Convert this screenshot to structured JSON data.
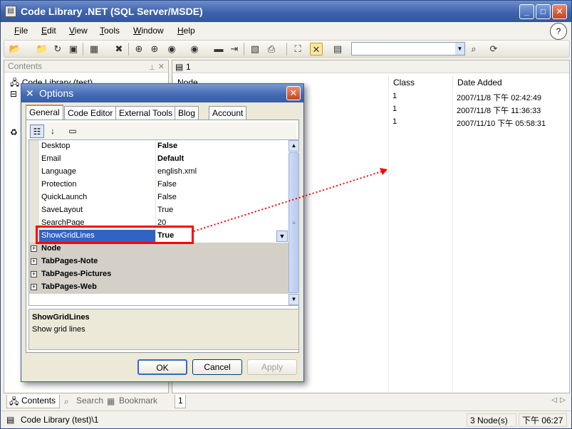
{
  "app": {
    "title": "Code Library .NET (SQL Server/MSDE)",
    "window_buttons": [
      "_",
      "□",
      "✕"
    ]
  },
  "menu": [
    {
      "label": "File",
      "u": "F",
      "rest": "ile"
    },
    {
      "label": "Edit",
      "u": "E",
      "rest": "dit"
    },
    {
      "label": "View",
      "u": "V",
      "rest": "iew"
    },
    {
      "label": "Tools",
      "u": "T",
      "rest": "ools"
    },
    {
      "label": "Window",
      "u": "W",
      "rest": "indow"
    },
    {
      "label": "Help",
      "u": "H",
      "rest": "elp"
    }
  ],
  "left_panel": {
    "title": "Contents",
    "root": "Code Library (test)"
  },
  "right_panel": {
    "tab_label": "1",
    "columns": [
      "Node",
      "Class",
      "Date Added"
    ],
    "rows": [
      {
        "class": "1",
        "date": "2007/11/8 下午 02:42:49"
      },
      {
        "class": "1",
        "date": "2007/11/8 下午 11:36:33"
      },
      {
        "class": "1",
        "date": "2007/11/10 下午 05:58:31"
      }
    ],
    "bottom_tab": "1"
  },
  "bottom_tabs": [
    "Contents",
    "Search",
    "Bookmark"
  ],
  "statusbar": {
    "path": "Code Library (test)\\1",
    "count": "3 Node(s)",
    "time": "下午 06:27"
  },
  "dialog": {
    "title": "Options",
    "tabs": [
      "General",
      "Code Editor",
      "External Tools",
      "Blog",
      "Account"
    ],
    "properties": [
      {
        "name": "Desktop",
        "value": "False",
        "bold": true
      },
      {
        "name": "Email",
        "value": "Default",
        "bold": true
      },
      {
        "name": "Language",
        "value": "english.xml",
        "bold": false
      },
      {
        "name": "Protection",
        "value": "False",
        "bold": false
      },
      {
        "name": "QuickLaunch",
        "value": "False",
        "bold": false
      },
      {
        "name": "SaveLayout",
        "value": "True",
        "bold": false
      },
      {
        "name": "SearchPage",
        "value": "20",
        "bold": false
      },
      {
        "name": "ShowGridLines",
        "value": "True",
        "bold": true
      }
    ],
    "categories": [
      "Node",
      "TabPages-Note",
      "TabPages-Pictures",
      "TabPages-Web"
    ],
    "description": {
      "title": "ShowGridLines",
      "text": "Show grid lines"
    },
    "buttons": {
      "ok": "OK",
      "cancel": "Cancel",
      "apply": "Apply"
    }
  },
  "colors": {
    "titlebar": "#3e63ab",
    "selection": "#3163c5",
    "highlight_box": "#ff0000"
  }
}
